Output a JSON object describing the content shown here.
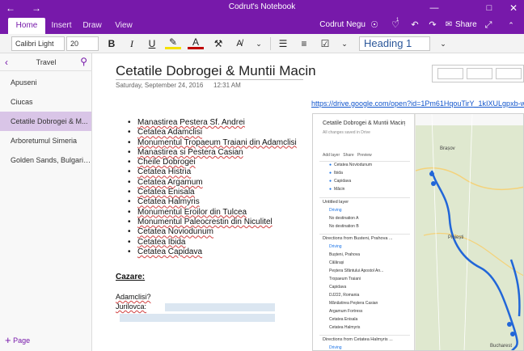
{
  "window": {
    "title": "Codrut's Notebook",
    "user": "Codrut Negu",
    "notification_count": "1",
    "share_label": "Share"
  },
  "tabs": [
    {
      "label": "Home",
      "active": true
    },
    {
      "label": "Insert",
      "active": false
    },
    {
      "label": "Draw",
      "active": false
    },
    {
      "label": "View",
      "active": false
    }
  ],
  "toolbar": {
    "font_name": "Calibri Light",
    "font_size": "20",
    "bold": "B",
    "italic": "I",
    "underline": "U",
    "style": "Heading 1"
  },
  "sidebar": {
    "section_name": "Travel",
    "pages": [
      {
        "label": "Apuseni",
        "selected": false
      },
      {
        "label": "Ciucas",
        "selected": false
      },
      {
        "label": "Cetatile Dobrogei & M...",
        "selected": true
      },
      {
        "label": "Arboretumul Simeria",
        "selected": false
      },
      {
        "label": "Golden Sands, Bulgaria...",
        "selected": false
      }
    ],
    "add_page_label": "Page"
  },
  "page": {
    "title": "Cetatile Dobrogei & Muntii Macin",
    "date": "Saturday, September 24, 2016",
    "time": "12:31 AM",
    "link": "https://drive.google.com/open?id=1Pm61HqouTirY_1kIXULgpxb-wi0",
    "bullets": [
      "Manastirea Pestera Sf. Andrei",
      "Cetatea Adamclisi",
      "Monumentul Tropaeum Traiani din Adamclisi",
      "Manastirea si Pestera Casian",
      "Cheile Dobrogei",
      "Cetatea Histria",
      "Cetatea Argamum",
      "Cetatea Enisala",
      "Cetatea Halmyris",
      "Monumentul Eroilor din Tulcea",
      "Monumentul Paleocrestin din Niculitel",
      "Cetatea Noviodunum",
      "Cetatea Ibida",
      "Cetatea Capidava"
    ],
    "cazare_label": "Cazare:",
    "note_1": "Adamclisi?",
    "note_2": "Jurilovca:"
  },
  "map": {
    "title": "Cetatile Dobrogei & Muntii Macin",
    "subtitle": "All changes saved in Drive",
    "add_layer": "Add layer",
    "share": "Share",
    "preview": "Preview",
    "places": [
      "Cetatea Noviodunum",
      "Ibida",
      "Capidava",
      "Măcin"
    ],
    "layer_1": "Untitled layer",
    "layer_1_mode": "Driving",
    "layer_1_items": [
      "No destination A",
      "No destination B"
    ],
    "layer_2": "Directions from Busteni, Prahova ...",
    "layer_2_mode": "Driving",
    "layer_2_items": [
      "Bușteni, Prahova",
      "Călărași",
      "Peștera Sfântului Apostol An...",
      "Tropaeum Traiani",
      "Capidava",
      "DJ222, Romania",
      "Mănăstirea Peștera Casian",
      "Argamum Fortress",
      "Cetatea Enisala",
      "Cetatea Halmyris"
    ],
    "layer_3": "Directions from Cetatea Halmyris ...",
    "layer_3_mode": "Driving",
    "city_labels": [
      "Brașov",
      "Ploiești",
      "Bucharest"
    ]
  }
}
